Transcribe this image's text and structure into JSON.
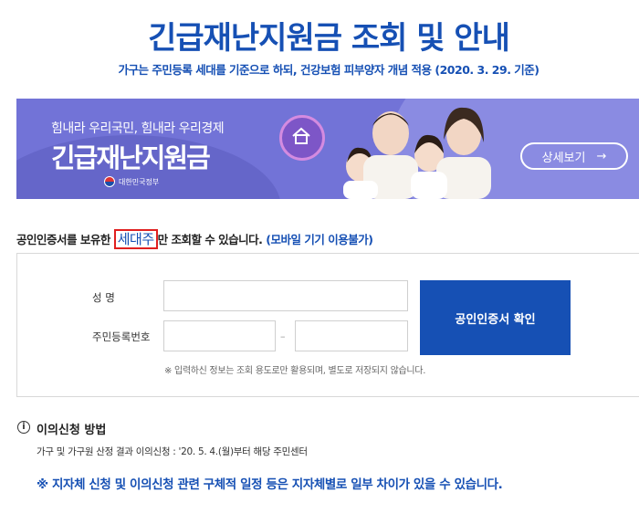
{
  "header": {
    "title": "긴급재난지원금 조회 및 안내",
    "subtitle": "가구는 주민등록 세대를 기준으로 하되, 건강보험 피부양자 개념 적용 (2020. 3. 29. 기준)"
  },
  "banner": {
    "tagline": "힘내라 우리국민, 힘내라 우리경제",
    "headline": "긴급재난지원금",
    "government": "대한민국정부",
    "detail_button": "상세보기",
    "detail_icon": "arrow-right-icon",
    "badge_icon": "house-icon",
    "colors": {
      "background": "#7273d7",
      "badge": "#7d56c7"
    }
  },
  "notice": {
    "prefix": "공인인증서를 보유한 ",
    "highlight": "세대주",
    "suffix": "만 조회할 수 있습니다.",
    "mobile_note": "(모바일 기기 이용불가)"
  },
  "form": {
    "name_label": "성    명",
    "rrn_label": "주민등록번호",
    "dash": "–",
    "confirm_button": "공인인증서 확인",
    "help_text": "※ 입력하신 정보는 조회 용도로만 활용되며, 별도로 저장되지 않습니다."
  },
  "objection": {
    "icon": "info-icon",
    "title": "이의신청 방법",
    "text": "가구 및 가구원 산정 결과 이의신청 : '20. 5. 4.(월)부터 해당 주민센터"
  },
  "disclaimer": "※ 지자체 신청 및 이의신청 관련 구체적 일정 등은 지자체별로 일부 차이가 있을 수 있습니다.",
  "colors": {
    "brand": "#1650b4",
    "highlight_border": "#e02020"
  }
}
